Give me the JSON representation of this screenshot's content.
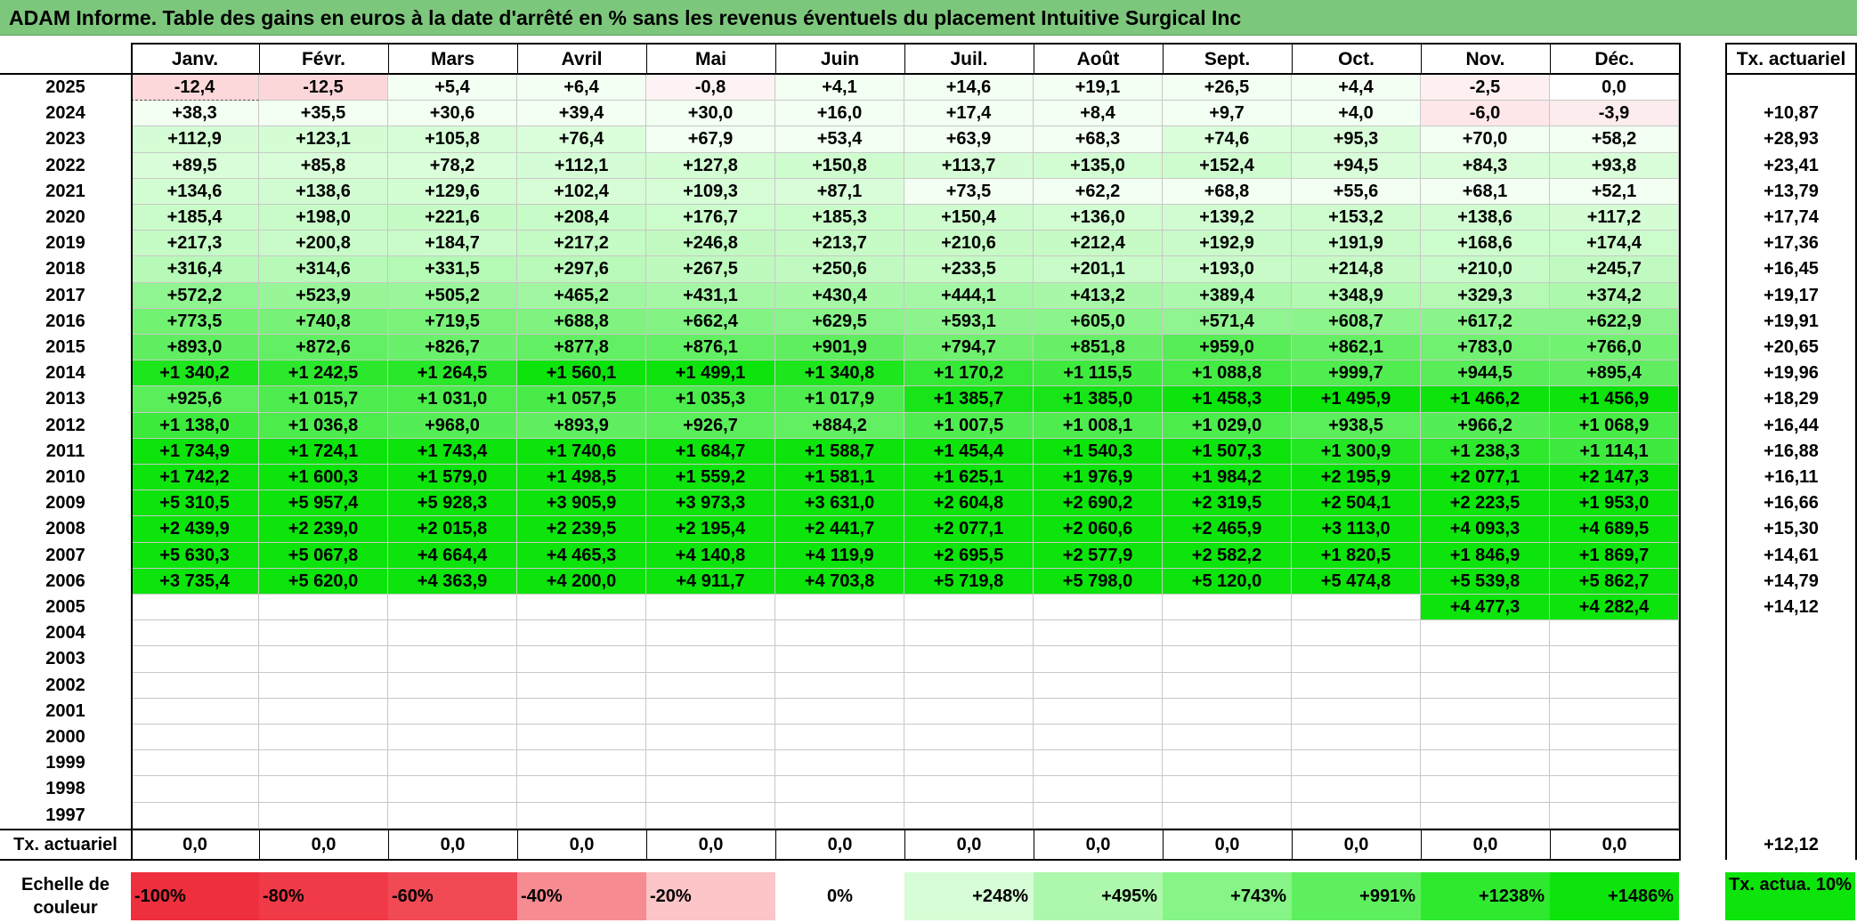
{
  "title": "ADAM Informe. Table des gains en euros à la date d'arrêté en % sans les revenus éventuels du placement Intuitive Surgical Inc",
  "months": [
    "Janv.",
    "Févr.",
    "Mars",
    "Avril",
    "Mai",
    "Juin",
    "Juil.",
    "Août",
    "Sept.",
    "Oct.",
    "Nov.",
    "Déc."
  ],
  "rate_header": "Tx. actuariel",
  "rows": [
    {
      "year": "2025",
      "values": [
        "-12,4",
        "-12,5",
        "+5,4",
        "+6,4",
        "-0,8",
        "+4,1",
        "+14,6",
        "+19,1",
        "+26,5",
        "+4,4",
        "-2,5",
        "0,0"
      ],
      "rate": ""
    },
    {
      "year": "2024",
      "values": [
        "+38,3",
        "+35,5",
        "+30,6",
        "+39,4",
        "+30,0",
        "+16,0",
        "+17,4",
        "+8,4",
        "+9,7",
        "+4,0",
        "-6,0",
        "-3,9"
      ],
      "rate": "+10,87"
    },
    {
      "year": "2023",
      "values": [
        "+112,9",
        "+123,1",
        "+105,8",
        "+76,4",
        "+67,9",
        "+53,4",
        "+63,9",
        "+68,3",
        "+74,6",
        "+95,3",
        "+70,0",
        "+58,2"
      ],
      "rate": "+28,93"
    },
    {
      "year": "2022",
      "values": [
        "+89,5",
        "+85,8",
        "+78,2",
        "+112,1",
        "+127,8",
        "+150,8",
        "+113,7",
        "+135,0",
        "+152,4",
        "+94,5",
        "+84,3",
        "+93,8"
      ],
      "rate": "+23,41"
    },
    {
      "year": "2021",
      "values": [
        "+134,6",
        "+138,6",
        "+129,6",
        "+102,4",
        "+109,3",
        "+87,1",
        "+73,5",
        "+62,2",
        "+68,8",
        "+55,6",
        "+68,1",
        "+52,1"
      ],
      "rate": "+13,79"
    },
    {
      "year": "2020",
      "values": [
        "+185,4",
        "+198,0",
        "+221,6",
        "+208,4",
        "+176,7",
        "+185,3",
        "+150,4",
        "+136,0",
        "+139,2",
        "+153,2",
        "+138,6",
        "+117,2"
      ],
      "rate": "+17,74"
    },
    {
      "year": "2019",
      "values": [
        "+217,3",
        "+200,8",
        "+184,7",
        "+217,2",
        "+246,8",
        "+213,7",
        "+210,6",
        "+212,4",
        "+192,9",
        "+191,9",
        "+168,6",
        "+174,4"
      ],
      "rate": "+17,36"
    },
    {
      "year": "2018",
      "values": [
        "+316,4",
        "+314,6",
        "+331,5",
        "+297,6",
        "+267,5",
        "+250,6",
        "+233,5",
        "+201,1",
        "+193,0",
        "+214,8",
        "+210,0",
        "+245,7"
      ],
      "rate": "+16,45"
    },
    {
      "year": "2017",
      "values": [
        "+572,2",
        "+523,9",
        "+505,2",
        "+465,2",
        "+431,1",
        "+430,4",
        "+444,1",
        "+413,2",
        "+389,4",
        "+348,9",
        "+329,3",
        "+374,2"
      ],
      "rate": "+19,17"
    },
    {
      "year": "2016",
      "values": [
        "+773,5",
        "+740,8",
        "+719,5",
        "+688,8",
        "+662,4",
        "+629,5",
        "+593,1",
        "+605,0",
        "+571,4",
        "+608,7",
        "+617,2",
        "+622,9"
      ],
      "rate": "+19,91"
    },
    {
      "year": "2015",
      "values": [
        "+893,0",
        "+872,6",
        "+826,7",
        "+877,8",
        "+876,1",
        "+901,9",
        "+794,7",
        "+851,8",
        "+959,0",
        "+862,1",
        "+783,0",
        "+766,0"
      ],
      "rate": "+20,65"
    },
    {
      "year": "2014",
      "values": [
        "+1 340,2",
        "+1 242,5",
        "+1 264,5",
        "+1 560,1",
        "+1 499,1",
        "+1 340,8",
        "+1 170,2",
        "+1 115,5",
        "+1 088,8",
        "+999,7",
        "+944,5",
        "+895,4"
      ],
      "rate": "+19,96"
    },
    {
      "year": "2013",
      "values": [
        "+925,6",
        "+1 015,7",
        "+1 031,0",
        "+1 057,5",
        "+1 035,3",
        "+1 017,9",
        "+1 385,7",
        "+1 385,0",
        "+1 458,3",
        "+1 495,9",
        "+1 466,2",
        "+1 456,9"
      ],
      "rate": "+18,29"
    },
    {
      "year": "2012",
      "values": [
        "+1 138,0",
        "+1 036,8",
        "+968,0",
        "+893,9",
        "+926,7",
        "+884,2",
        "+1 007,5",
        "+1 008,1",
        "+1 029,0",
        "+938,5",
        "+966,2",
        "+1 068,9"
      ],
      "rate": "+16,44"
    },
    {
      "year": "2011",
      "values": [
        "+1 734,9",
        "+1 724,1",
        "+1 743,4",
        "+1 740,6",
        "+1 684,7",
        "+1 588,7",
        "+1 454,4",
        "+1 540,3",
        "+1 507,3",
        "+1 300,9",
        "+1 238,3",
        "+1 114,1"
      ],
      "rate": "+16,88"
    },
    {
      "year": "2010",
      "values": [
        "+1 742,2",
        "+1 600,3",
        "+1 579,0",
        "+1 498,5",
        "+1 559,2",
        "+1 581,1",
        "+1 625,1",
        "+1 976,9",
        "+1 984,2",
        "+2 195,9",
        "+2 077,1",
        "+2 147,3"
      ],
      "rate": "+16,11"
    },
    {
      "year": "2009",
      "values": [
        "+5 310,5",
        "+5 957,4",
        "+5 928,3",
        "+3 905,9",
        "+3 973,3",
        "+3 631,0",
        "+2 604,8",
        "+2 690,2",
        "+2 319,5",
        "+2 504,1",
        "+2 223,5",
        "+1 953,0"
      ],
      "rate": "+16,66"
    },
    {
      "year": "2008",
      "values": [
        "+2 439,9",
        "+2 239,0",
        "+2 015,8",
        "+2 239,5",
        "+2 195,4",
        "+2 441,7",
        "+2 077,1",
        "+2 060,6",
        "+2 465,9",
        "+3 113,0",
        "+4 093,3",
        "+4 689,5"
      ],
      "rate": "+15,30"
    },
    {
      "year": "2007",
      "values": [
        "+5 630,3",
        "+5 067,8",
        "+4 664,4",
        "+4 465,3",
        "+4 140,8",
        "+4 119,9",
        "+2 695,5",
        "+2 577,9",
        "+2 582,2",
        "+1 820,5",
        "+1 846,9",
        "+1 869,7"
      ],
      "rate": "+14,61"
    },
    {
      "year": "2006",
      "values": [
        "+3 735,4",
        "+5 620,0",
        "+4 363,9",
        "+4 200,0",
        "+4 911,7",
        "+4 703,8",
        "+5 719,8",
        "+5 798,0",
        "+5 120,0",
        "+5 474,8",
        "+5 539,8",
        "+5 862,7"
      ],
      "rate": "+14,79"
    },
    {
      "year": "2005",
      "values": [
        "",
        "",
        "",
        "",
        "",
        "",
        "",
        "",
        "",
        "",
        "+4 477,3",
        "+4 282,4"
      ],
      "rate": "+14,12"
    },
    {
      "year": "2004",
      "values": [
        "",
        "",
        "",
        "",
        "",
        "",
        "",
        "",
        "",
        "",
        "",
        ""
      ],
      "rate": ""
    },
    {
      "year": "2003",
      "values": [
        "",
        "",
        "",
        "",
        "",
        "",
        "",
        "",
        "",
        "",
        "",
        ""
      ],
      "rate": ""
    },
    {
      "year": "2002",
      "values": [
        "",
        "",
        "",
        "",
        "",
        "",
        "",
        "",
        "",
        "",
        "",
        ""
      ],
      "rate": ""
    },
    {
      "year": "2001",
      "values": [
        "",
        "",
        "",
        "",
        "",
        "",
        "",
        "",
        "",
        "",
        "",
        ""
      ],
      "rate": ""
    },
    {
      "year": "2000",
      "values": [
        "",
        "",
        "",
        "",
        "",
        "",
        "",
        "",
        "",
        "",
        "",
        ""
      ],
      "rate": ""
    },
    {
      "year": "1999",
      "values": [
        "",
        "",
        "",
        "",
        "",
        "",
        "",
        "",
        "",
        "",
        "",
        ""
      ],
      "rate": ""
    },
    {
      "year": "1998",
      "values": [
        "",
        "",
        "",
        "",
        "",
        "",
        "",
        "",
        "",
        "",
        "",
        ""
      ],
      "rate": ""
    },
    {
      "year": "1997",
      "values": [
        "",
        "",
        "",
        "",
        "",
        "",
        "",
        "",
        "",
        "",
        "",
        ""
      ],
      "rate": ""
    }
  ],
  "footer": {
    "label": "Tx. actuariel",
    "values": [
      "0,0",
      "0,0",
      "0,0",
      "0,0",
      "0,0",
      "0,0",
      "0,0",
      "0,0",
      "0,0",
      "0,0",
      "0,0",
      "0,0"
    ],
    "rate": "+12,12"
  },
  "legend": {
    "label": "Echelle de couleur",
    "items": [
      {
        "text": "-100%",
        "color": "#ee2f3d"
      },
      {
        "text": "-80%",
        "color": "#f03a47"
      },
      {
        "text": "-60%",
        "color": "#f24a55"
      },
      {
        "text": "-40%",
        "color": "#f78b92"
      },
      {
        "text": "-20%",
        "color": "#fcc5c8"
      },
      {
        "text": "0%",
        "color": "#ffffff"
      },
      {
        "text": "+248%",
        "color": "#d6fdd6"
      },
      {
        "text": "+495%",
        "color": "#aef8ae"
      },
      {
        "text": "+743%",
        "color": "#86f486"
      },
      {
        "text": "+991%",
        "color": "#5eef5e"
      },
      {
        "text": "+1238%",
        "color": "#2fe92f"
      },
      {
        "text": "+1486%",
        "color": "#0ce40c"
      }
    ],
    "rate_label": "Tx. actua. 10%",
    "rate_color": "#0ce40c"
  },
  "colors": {
    "title_bar": "#7dc77d",
    "positive_max": "#0ce40c",
    "negative_max": "#ee2f3d",
    "light_positive": "#f2fff2"
  }
}
